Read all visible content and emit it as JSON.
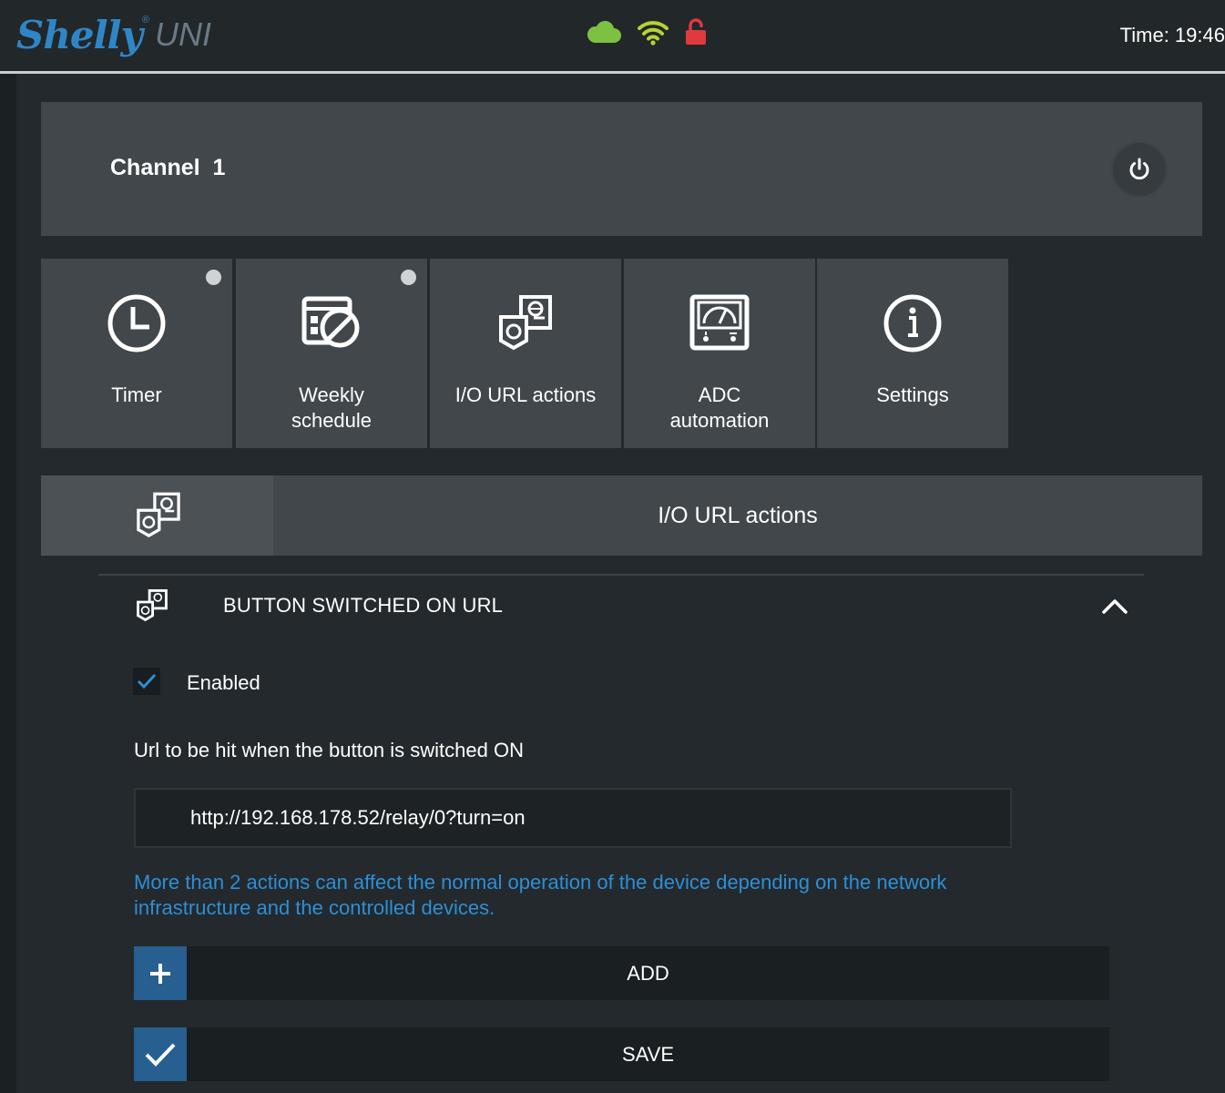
{
  "header": {
    "brand": "Shelly",
    "brand_mark": "®",
    "model": "UNI",
    "status_icons": [
      {
        "name": "cloud-icon",
        "color": "#7cc142"
      },
      {
        "name": "wifi-icon",
        "color": "#b6d335"
      },
      {
        "name": "lock-icon",
        "color": "#e0393e"
      }
    ],
    "time": "Time: 19:46"
  },
  "channel": {
    "title": "Channel  1",
    "power_icon": "power-icon"
  },
  "tiles": [
    {
      "label": "Timer",
      "icon": "clock-icon",
      "dot": true
    },
    {
      "label": "Weekly\nschedule",
      "icon": "calendar-off-icon",
      "dot": true
    },
    {
      "label": "I/O URL actions",
      "icon": "io-url-icon",
      "dot": false
    },
    {
      "label": "ADC\nautomation",
      "icon": "gauge-icon",
      "dot": false
    },
    {
      "label": "Settings",
      "icon": "info-icon",
      "dot": false
    }
  ],
  "section": {
    "title": "I/O URL actions",
    "icon": "io-url-icon"
  },
  "panel": {
    "title": "BUTTON SWITCHED ON URL",
    "icon": "io-url-icon",
    "collapse_icon": "chevron-up-icon",
    "enabled": {
      "label": "Enabled",
      "checked": true
    },
    "url_label": "Url to be hit when the button is switched ON",
    "url_value": "http://192.168.178.52/relay/0?turn=on",
    "warning": "More than 2 actions can affect the normal operation of the device depending on the network infrastructure and the controlled devices.",
    "add_label": "ADD",
    "save_label": "SAVE"
  },
  "colors": {
    "accent": "#2d8fd5",
    "button_icon_bg": "#275f90",
    "card_bg": "#41474b",
    "page_bg": "#23292d"
  }
}
